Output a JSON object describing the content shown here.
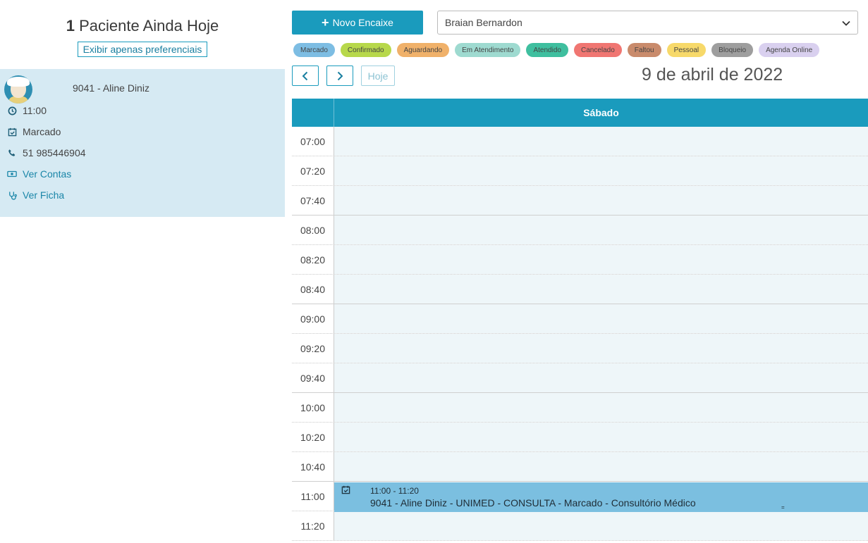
{
  "left": {
    "title_count": "1",
    "title_text": "Paciente Ainda Hoje",
    "pref_button": "Exibir apenas preferenciais",
    "patient": {
      "name": "9041 - Aline Diniz",
      "time": "11:00",
      "status": "Marcado",
      "phone": "51 985446904",
      "ver_contas": "Ver Contas",
      "ver_ficha": "Ver Ficha"
    }
  },
  "toolbar": {
    "novo_encaixe": "Novo Encaixe",
    "doctor_selected": "Braian Bernardon",
    "hoje": "Hoje",
    "date_title": "9 de abril de 2022"
  },
  "legend": [
    {
      "label": "Marcado",
      "color": "#7dbde3"
    },
    {
      "label": "Confirmado",
      "color": "#b7d84b"
    },
    {
      "label": "Aguardando",
      "color": "#f0b16a"
    },
    {
      "label": "Em Atendimento",
      "color": "#9edad0"
    },
    {
      "label": "Atendido",
      "color": "#3fbf9f"
    },
    {
      "label": "Cancelado",
      "color": "#f07672"
    },
    {
      "label": "Faltou",
      "color": "#c98b6c"
    },
    {
      "label": "Pessoal",
      "color": "#f7d96a"
    },
    {
      "label": "Bloqueio",
      "color": "#9e9e9e"
    },
    {
      "label": "Agenda Online",
      "color": "#d9d0ef"
    }
  ],
  "calendar": {
    "day_header": "Sábado",
    "times": [
      "07:00",
      "07:20",
      "07:40",
      "08:00",
      "08:20",
      "08:40",
      "09:00",
      "09:20",
      "09:40",
      "10:00",
      "10:20",
      "10:40",
      "11:00",
      "11:20"
    ],
    "event": {
      "time_range": "11:00 - 11:20",
      "description": "9041 - Aline Diniz - UNIMED - CONSULTA - Marcado - Consultório Médico",
      "handle": "="
    }
  },
  "colors": {
    "primary": "#1a9bbd",
    "patient_card_bg": "#d6eaf3",
    "slot_bg": "#eef6f9",
    "event_bg": "#7bbfe0"
  }
}
